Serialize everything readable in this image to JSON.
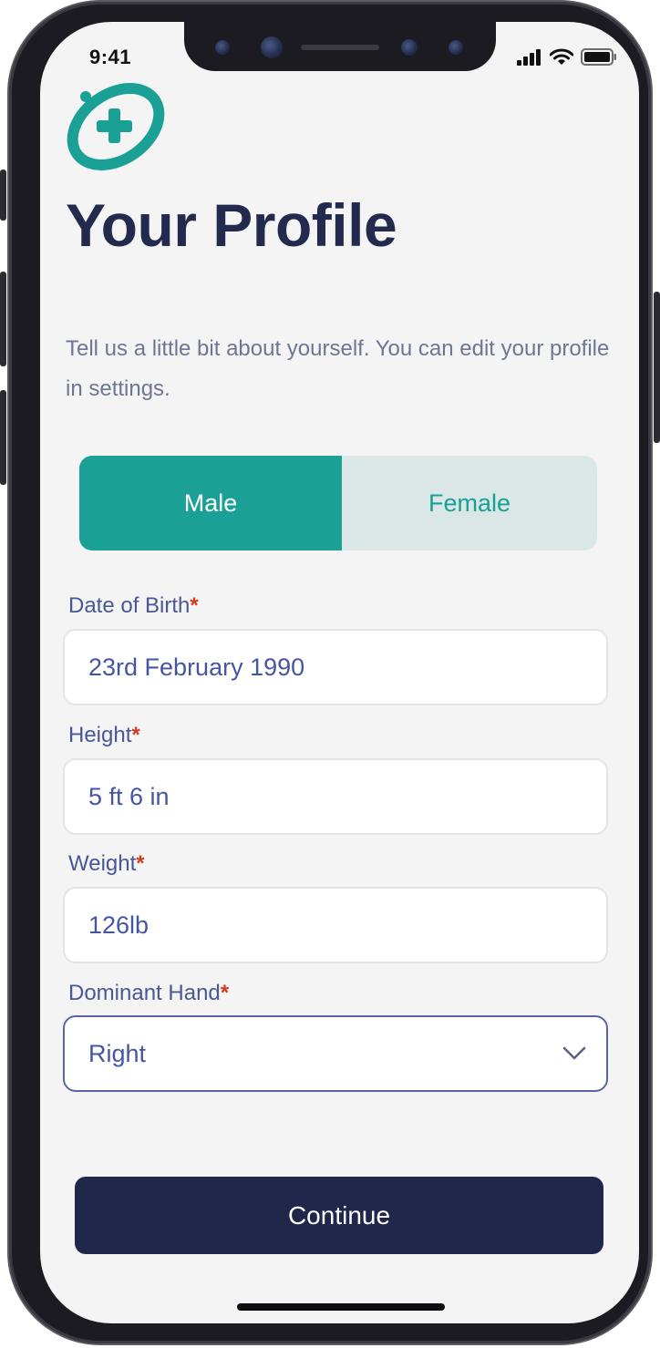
{
  "status": {
    "time": "9:41"
  },
  "header": {
    "title": "Your Profile",
    "subtitle": "Tell us a little bit about yourself. You can edit your profile in settings."
  },
  "gender": {
    "options": [
      "Male",
      "Female"
    ],
    "selected": "Male"
  },
  "form": {
    "dob": {
      "label": "Date of Birth",
      "required_mark": "*",
      "value": "23rd February 1990"
    },
    "height": {
      "label": "Height",
      "required_mark": "*",
      "value": "5 ft 6 in"
    },
    "weight": {
      "label": "Weight",
      "required_mark": "*",
      "value": "126lb"
    },
    "dominant_hand": {
      "label": "Dominant Hand",
      "required_mark": "*",
      "value": "Right"
    }
  },
  "actions": {
    "continue_label": "Continue"
  },
  "colors": {
    "teal": "#1ba096",
    "navy": "#21264b",
    "label_blue": "#4a5795",
    "required_red": "#d23b1e"
  },
  "icons": [
    "app-logo-icon",
    "signal-icon",
    "wifi-icon",
    "battery-icon",
    "chevron-down-icon"
  ]
}
